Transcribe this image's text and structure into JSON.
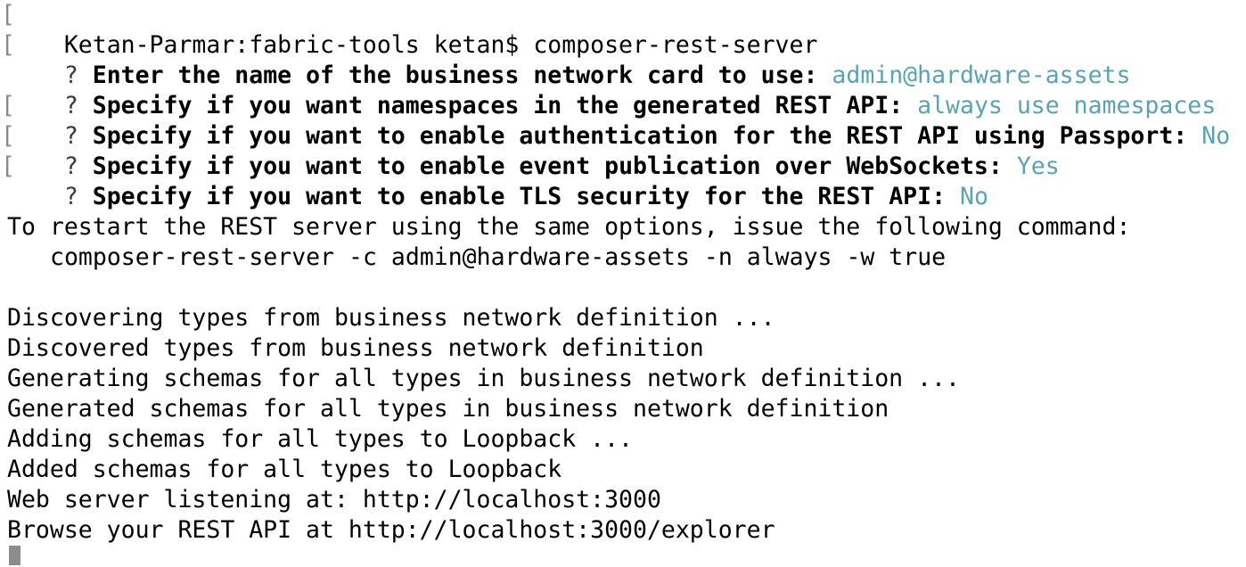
{
  "terminal": {
    "command_line": "Ketan-Parmar:fabric-tools ketan$ composer-rest-server",
    "prompts": [
      {
        "mark": "?",
        "question": "Enter the name of the business network card to use:",
        "answer": "admin@hardware-assets"
      },
      {
        "mark": "?",
        "question": "Specify if you want namespaces in the generated REST API:",
        "answer": "always use namespaces"
      },
      {
        "mark": "?",
        "question": "Specify if you want to enable authentication for the REST API using Passport:",
        "answer": "No"
      },
      {
        "mark": "?",
        "question": "Specify if you want to enable event publication over WebSockets:",
        "answer": "Yes"
      },
      {
        "mark": "?",
        "question": "Specify if you want to enable TLS security for the REST API:",
        "answer": "No"
      }
    ],
    "restart_notice": "To restart the REST server using the same options, issue the following command:",
    "restart_command": "composer-rest-server -c admin@hardware-assets -n always -w true",
    "output_lines": [
      "Discovering types from business network definition ...",
      "Discovered types from business network definition",
      "Generating schemas for all types in business network definition ...",
      "Generated schemas for all types in business network definition",
      "Adding schemas for all types to Loopback ...",
      "Added schemas for all types to Loopback",
      "Web server listening at: http://localhost:3000",
      "Browse your REST API at http://localhost:3000/explorer"
    ],
    "colors": {
      "background": "#ffffff",
      "text": "#000000",
      "answer": "#5aa3b2",
      "cursor": "#8c8c8c"
    }
  }
}
